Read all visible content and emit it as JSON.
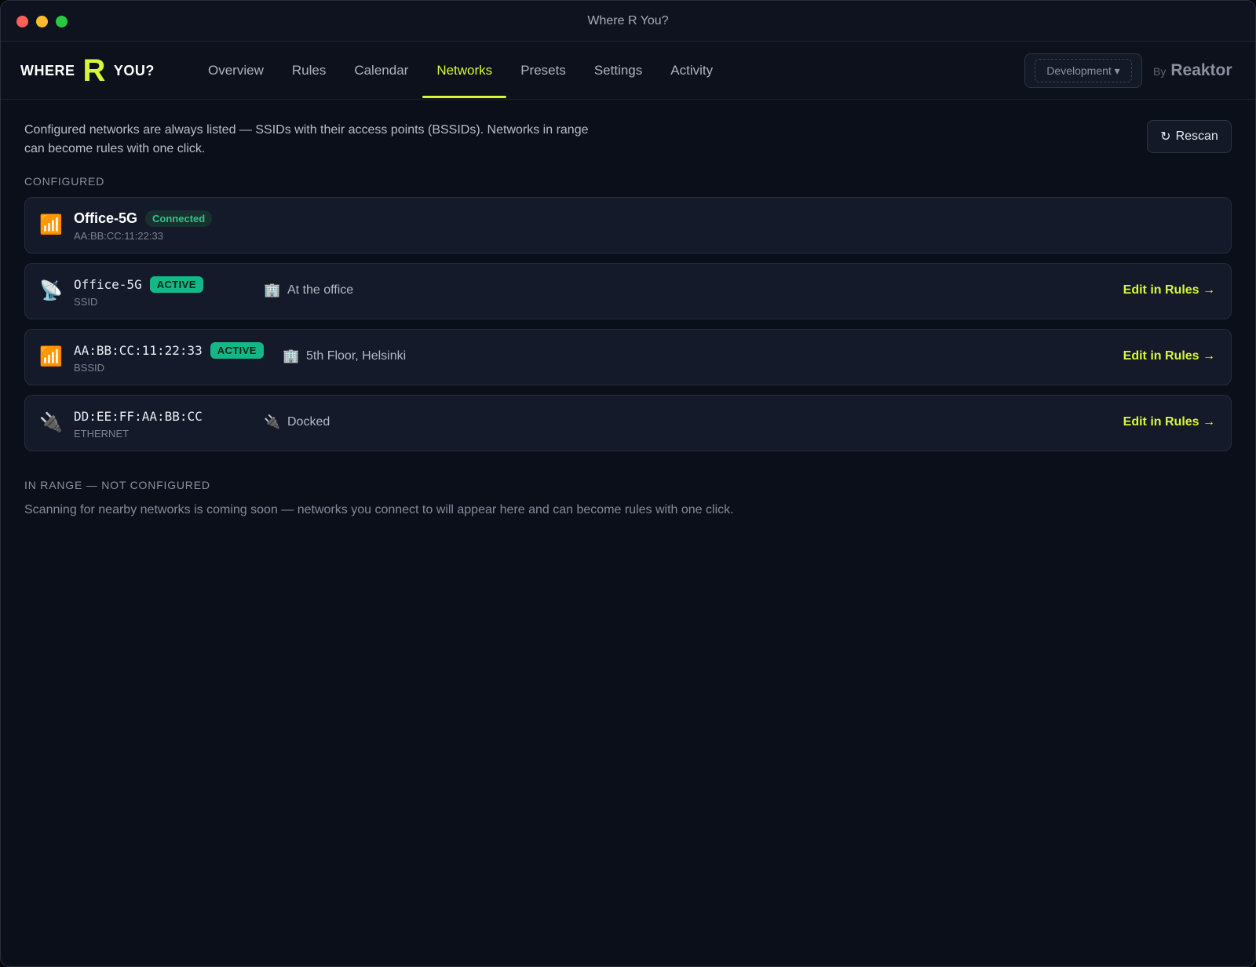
{
  "window": {
    "title": "Where R You?"
  },
  "logo": {
    "left": "WHERE",
    "mark": "R",
    "right": "YOU?"
  },
  "nav": {
    "tabs": [
      "Overview",
      "Rules",
      "Calendar",
      "Networks",
      "Presets",
      "Settings",
      "Activity"
    ],
    "active_tab": "Networks"
  },
  "environment": {
    "label": "Development ▾"
  },
  "byline": {
    "by": "By",
    "brand": "Reaktor"
  },
  "intro": "Configured networks are always listed — SSIDs with their access points (BSSIDs). Networks in range can become rules with one click.",
  "rescan": {
    "icon": "↻",
    "label": "Rescan"
  },
  "configured": {
    "label": "CONFIGURED",
    "connected": {
      "icon": "wifi-icon",
      "name": "Office-5G",
      "badge": "Connected",
      "sub": "AA:BB:CC:11:22:33"
    },
    "rules": [
      {
        "icon": "satellite-dish-icon",
        "name": "Office-5G",
        "badge": "ACTIVE",
        "kind": "SSID",
        "target_icon": "office-building-icon",
        "target": "At the office",
        "action": "Edit in Rules →"
      },
      {
        "icon": "wifi-icon",
        "name": "AA:BB:CC:11:22:33",
        "badge": "ACTIVE",
        "kind": "BSSID",
        "target_icon": "office-building-icon",
        "target": "5th Floor, Helsinki",
        "action": "Edit in Rules →"
      },
      {
        "icon": "plug-icon",
        "name": "DD:EE:FF:AA:BB:CC",
        "badge": "",
        "kind": "ETHERNET",
        "target_icon": "plug-icon",
        "target": "Docked",
        "action": "Edit in Rules →"
      }
    ]
  },
  "in_range": {
    "label": "IN RANGE — NOT CONFIGURED",
    "empty": "Scanning for nearby networks is coming soon — networks you connect to will appear here and can become rules with one click."
  },
  "colors": {
    "accent": "#d8f53a",
    "active_badge": "#13b886",
    "connected_text": "#2dc58e",
    "background": "#0b0f1a",
    "card": "#151a2a"
  }
}
